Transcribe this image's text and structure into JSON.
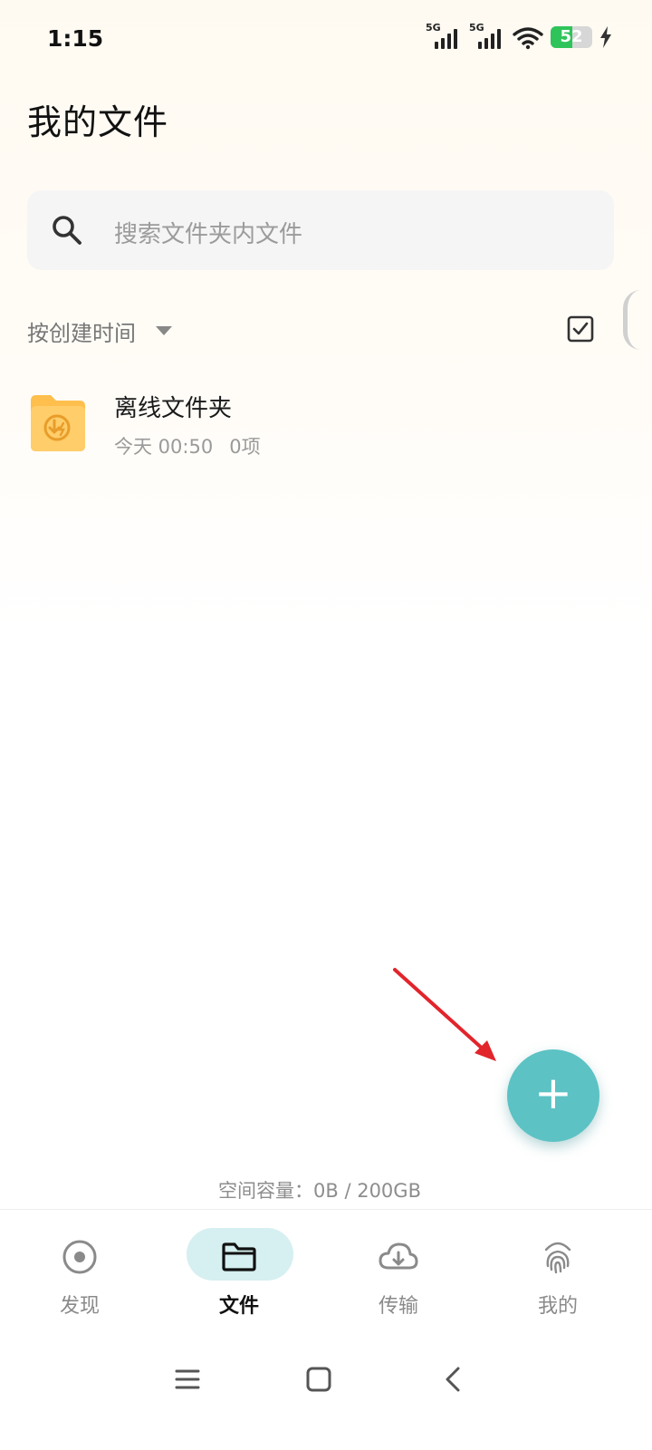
{
  "status_bar": {
    "time": "1:15",
    "signal_1": "5G",
    "signal_2": "5G",
    "battery_level": "52",
    "battery_percent": 52,
    "charging": true
  },
  "page": {
    "title": "我的文件"
  },
  "search": {
    "placeholder": "搜索文件夹内文件"
  },
  "sort": {
    "label": "按创建时间"
  },
  "files": [
    {
      "name": "离线文件夹",
      "date": "今天 00:50",
      "count": "0项",
      "icon": "offline-download-folder-icon"
    }
  ],
  "storage": {
    "text": "空间容量：0B / 200GB"
  },
  "bottom_nav": {
    "items": [
      {
        "label": "发现",
        "icon": "discover-icon",
        "active": false
      },
      {
        "label": "文件",
        "icon": "folder-icon",
        "active": true
      },
      {
        "label": "传输",
        "icon": "cloud-download-icon",
        "active": false
      },
      {
        "label": "我的",
        "icon": "fingerprint-icon",
        "active": false
      }
    ]
  },
  "colors": {
    "accent": "#5cc2c4",
    "active_tab_bg": "#d6eff0",
    "folder": "#ffc65a",
    "arrow": "#e2242b"
  },
  "fab": {
    "icon": "plus-icon"
  }
}
